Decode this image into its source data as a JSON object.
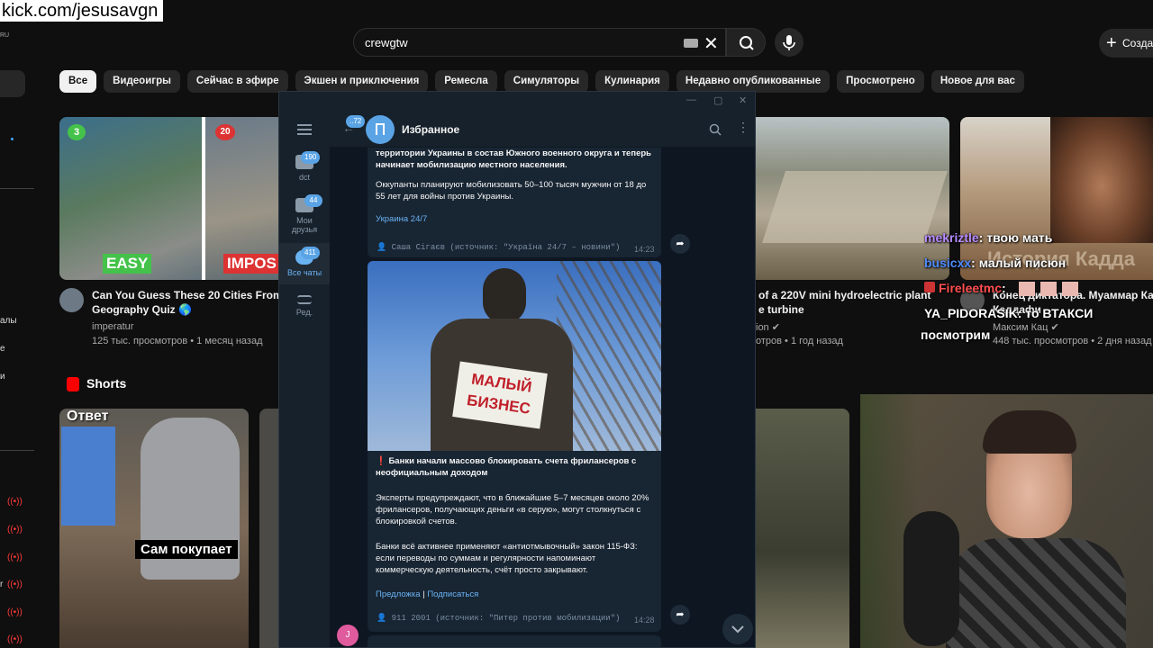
{
  "stream_url": "kick.com/jesusavgn",
  "youtube": {
    "region": "RU",
    "search_value": "crewgtw",
    "create_label": "Созда",
    "chips": [
      "Все",
      "Видеоигры",
      "Сейчас в эфире",
      "Экшен и приключения",
      "Ремесла",
      "Симуляторы",
      "Кулинария",
      "Недавно опубликованные",
      "Просмотрено",
      "Новое для вас"
    ],
    "sidebar_fragments": [
      "алы",
      "е",
      "и",
      "r"
    ],
    "videos": [
      {
        "badge_left": "3",
        "badge_right": "20",
        "thumb_left_label": "EASY",
        "thumb_right_label": "IMPOS",
        "title_line1": "Can You Guess These 20 Cities From A",
        "title_line2": "Geography Quiz 🌎",
        "channel": "imperatur",
        "stats": "125 тыс. просмотров • 1 месяц назад"
      },
      {
        "title_line1": "of a 220V mini hydroelectric plant",
        "title_line2": "e turbine",
        "channel": "ion ✔",
        "stats": "отров • 1 год назад"
      },
      {
        "thumb_label": "История Кадда",
        "title_line1": "Конец диктатора. Муаммар Ка",
        "title_line2": "Каддафи",
        "channel": "Максим Кац ✔",
        "stats": "448 тыс. просмотров • 2 дня назад"
      }
    ],
    "shorts_label": "Shorts",
    "short1_top": "Ответ",
    "short1_caption": "Сам покупает"
  },
  "chat_overlay": [
    {
      "user": "mekriztle",
      "text": ": твою мать",
      "color": "#b78bff"
    },
    {
      "user": "busicxx",
      "text": ": малый писюн",
      "color": "#4f8cff"
    },
    {
      "user": "Fireleetmc",
      "text": ":",
      "color": "#ff4f4f"
    },
    {
      "user": "YA_PIDORASIK",
      "text": ": то ВТАКСИ",
      "color": "#ffffff"
    },
    {
      "user": "",
      "text": "посмотрим",
      "color": "#ffffff"
    }
  ],
  "telegram": {
    "chat_title": "Избранное",
    "back_badge": "..72",
    "rail": [
      {
        "label": "dct",
        "badge": "190"
      },
      {
        "label": "Мои друзья",
        "badge": "44"
      },
      {
        "label": "Все чаты",
        "badge": "411"
      },
      {
        "label": "Ред.",
        "badge": ""
      }
    ],
    "msg1": {
      "text_a": "территории Украины в состав Южного военного округа и теперь начинает мобилизацию местного населения.",
      "text_b": "Оккупанты планируют мобилизовать 50–100 тысяч мужчин от 18 до 55 лет для войны против Украины.",
      "link": "Украина 24/7",
      "signature": "👤 Саша Сігаєв (источник: \"Україна 24/7 – новини\")",
      "time": "14:23"
    },
    "msg2": {
      "image_sign": "МАЛЫЙ БИЗНЕС",
      "headline": "❗ Банки начали массово блокировать счета фрилансеров с неофициальным доходом",
      "para1": "Эксперты предупреждают, что в ближайшие 5–7 месяцев около 20% фрилансеров, получающих деньги «в серую», могут столкнуться с блокировкой счетов.",
      "para2": "Банки всё активнее применяют «антиотмывочный» закон 115-ФЗ: если переводы по суммам и регулярности напоминают коммерческую деятельность, счёт просто закрывают.",
      "link1": "Предложка",
      "separator": "|",
      "link2": "Подписаться",
      "signature": "👤 911 2001 (источник: \"Питер против мобилизации\")",
      "time": "14:28"
    },
    "avatar_letter": "J",
    "colors": {
      "bg": "#0e1621",
      "panel": "#17212b",
      "bubble": "#182533",
      "accent": "#5aa4e6",
      "link": "#6ab3f3"
    }
  }
}
